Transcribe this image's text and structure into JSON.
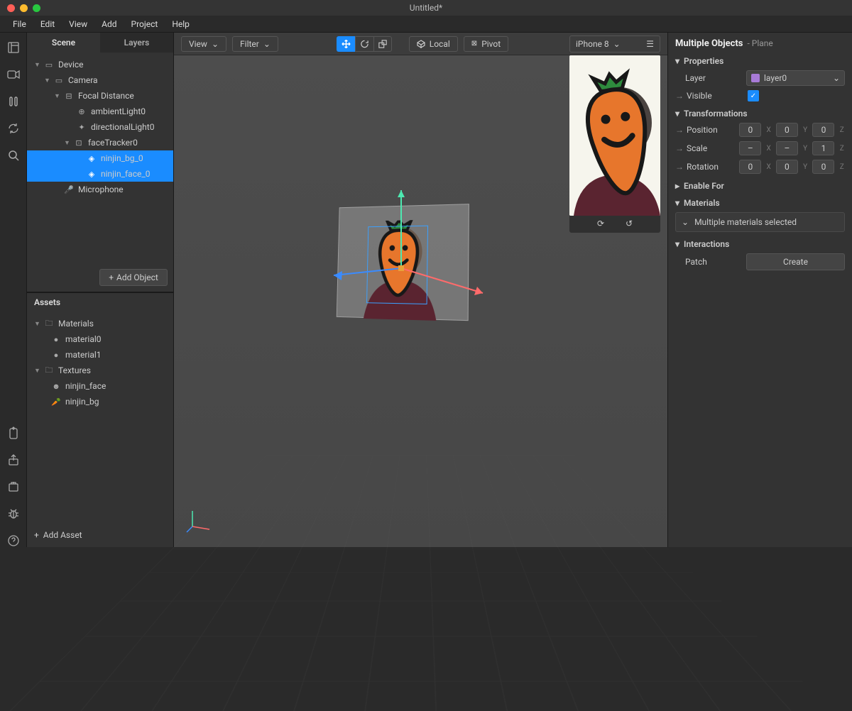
{
  "window": {
    "title": "Untitled*"
  },
  "menu": {
    "file": "File",
    "edit": "Edit",
    "view": "View",
    "add": "Add",
    "project": "Project",
    "help": "Help"
  },
  "scene_panel": {
    "tab_scene": "Scene",
    "tab_layers": "Layers",
    "device": "Device",
    "camera": "Camera",
    "focal": "Focal Distance",
    "ambient": "ambientLight0",
    "directional": "directionalLight0",
    "tracker": "faceTracker0",
    "ninjin_bg": "ninjin_bg_0",
    "ninjin_face": "ninjin_face_0",
    "microphone": "Microphone",
    "add_object": "Add Object"
  },
  "assets": {
    "title": "Assets",
    "materials": "Materials",
    "material0": "material0",
    "material1": "material1",
    "textures": "Textures",
    "ninjin_face": "ninjin_face",
    "ninjin_bg": "ninjin_bg",
    "add_asset": "Add Asset"
  },
  "viewport": {
    "view": "View",
    "filter": "Filter",
    "local": "Local",
    "pivot": "Pivot"
  },
  "preview": {
    "device": "iPhone 8"
  },
  "inspector": {
    "title": "Multiple Objects",
    "subtitle": "- Plane",
    "properties": "Properties",
    "layer": "Layer",
    "layer_value": "layer0",
    "visible": "Visible",
    "transformations": "Transformations",
    "position": "Position",
    "scale": "Scale",
    "rotation": "Rotation",
    "pos": {
      "x": "0",
      "y": "0",
      "z": "0"
    },
    "scl": {
      "x": "–",
      "y": "–",
      "z": "1"
    },
    "rot": {
      "x": "0",
      "y": "0",
      "z": "0"
    },
    "enable_for": "Enable For",
    "materials": "Materials",
    "materials_text": "Multiple materials selected",
    "interactions": "Interactions",
    "patch": "Patch",
    "create": "Create"
  }
}
